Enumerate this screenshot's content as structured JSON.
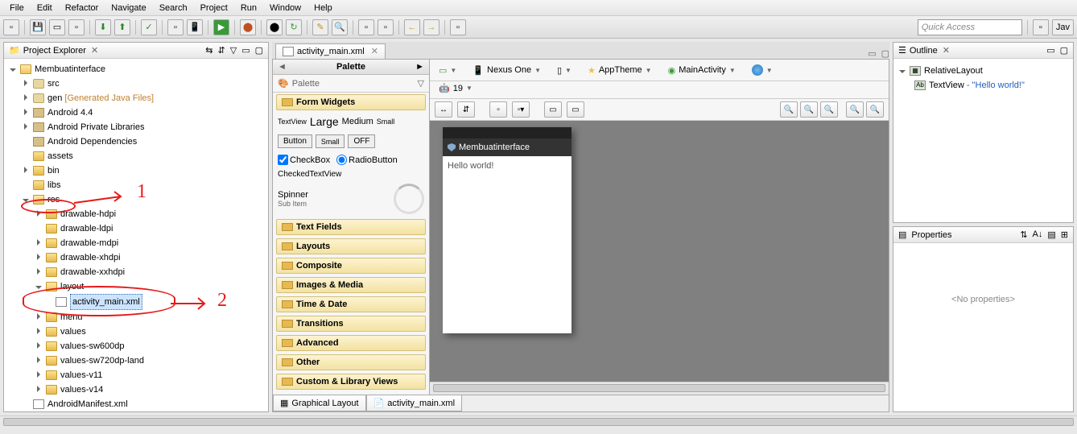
{
  "menu": [
    "File",
    "Edit",
    "Refactor",
    "Navigate",
    "Search",
    "Project",
    "Run",
    "Window",
    "Help"
  ],
  "quick_access": "Quick Access",
  "perspective": "Jav",
  "explorer": {
    "title": "Project Explorer",
    "project": "Membuatinterface",
    "nodes": {
      "src": "src",
      "gen": "gen",
      "gen_suffix": " [Generated Java Files]",
      "android44": "Android 4.4",
      "apl": "Android Private Libraries",
      "adeps": "Android Dependencies",
      "assets": "assets",
      "bin": "bin",
      "libs": "libs",
      "res": "res",
      "drawable_hdpi": "drawable-hdpi",
      "drawable_ldpi": "drawable-ldpi",
      "drawable_mdpi": "drawable-mdpi",
      "drawable_xhdpi": "drawable-xhdpi",
      "drawable_xxhdpi": "drawable-xxhdpi",
      "layout": "layout",
      "activity_main": "activity_main.xml",
      "menu": "menu",
      "values": "values",
      "values_sw600": "values-sw600dp",
      "values_sw720": "values-sw720dp-land",
      "values_v11": "values-v11",
      "values_v14": "values-v14",
      "manifest": "AndroidManifest.xml"
    }
  },
  "editor": {
    "tab": "activity_main.xml",
    "graphical_tab": "Graphical Layout",
    "xml_tab": "activity_main.xml"
  },
  "palette": {
    "title": "Palette",
    "search_label": "Palette",
    "form_widgets": "Form Widgets",
    "textview": "TextView",
    "large": "Large",
    "medium": "Medium",
    "small": "Small",
    "button": "Button",
    "small_btn": "Small",
    "off": "OFF",
    "checkbox": "CheckBox",
    "radio": "RadioButton",
    "checked_tv": "CheckedTextView",
    "spinner": "Spinner",
    "subitem": "Sub Item",
    "text_fields": "Text Fields",
    "layouts": "Layouts",
    "composite": "Composite",
    "images_media": "Images & Media",
    "time_date": "Time & Date",
    "transitions": "Transitions",
    "advanced": "Advanced",
    "other": "Other",
    "custom": "Custom & Library Views"
  },
  "canvas": {
    "device": "Nexus One",
    "theme": "AppTheme",
    "activity": "MainActivity",
    "api": "19",
    "app_title": "Membuatinterface",
    "hello": "Hello world!"
  },
  "outline": {
    "title": "Outline",
    "root": "RelativeLayout",
    "textview": "TextView",
    "textview_val": " - \"Hello world!\""
  },
  "properties": {
    "title": "Properties",
    "empty": "<No properties>"
  },
  "annotations": {
    "one": "1",
    "two": "2"
  }
}
